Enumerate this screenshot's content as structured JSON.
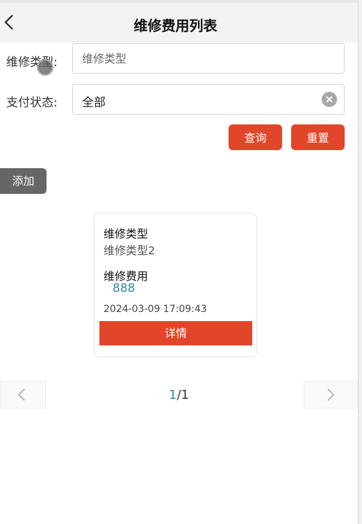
{
  "header": {
    "title": "维修费用列表",
    "back_icon": "chevron-left-icon"
  },
  "filters": {
    "type_label": "维修类型:",
    "type_placeholder": "维修类型",
    "status_label": "支付状态:",
    "status_value": "全部",
    "clear_icon": "clear-circle-icon"
  },
  "actions": {
    "query_label": "查询",
    "reset_label": "重置",
    "add_label": "添加"
  },
  "records": [
    {
      "type_label": "维修类型",
      "type_value": "维修类型2",
      "fee_label": "维修费用",
      "fee_value": "888",
      "time": "2024-03-09 17:09:43",
      "detail_label": "详情"
    }
  ],
  "pagination": {
    "current": "1",
    "separator": "/",
    "total": "1",
    "prev_icon": "chevron-left-icon",
    "next_icon": "chevron-right-icon"
  },
  "colors": {
    "accent": "#e1462a",
    "link": "#2f8fa1",
    "add_button": "#666666"
  }
}
